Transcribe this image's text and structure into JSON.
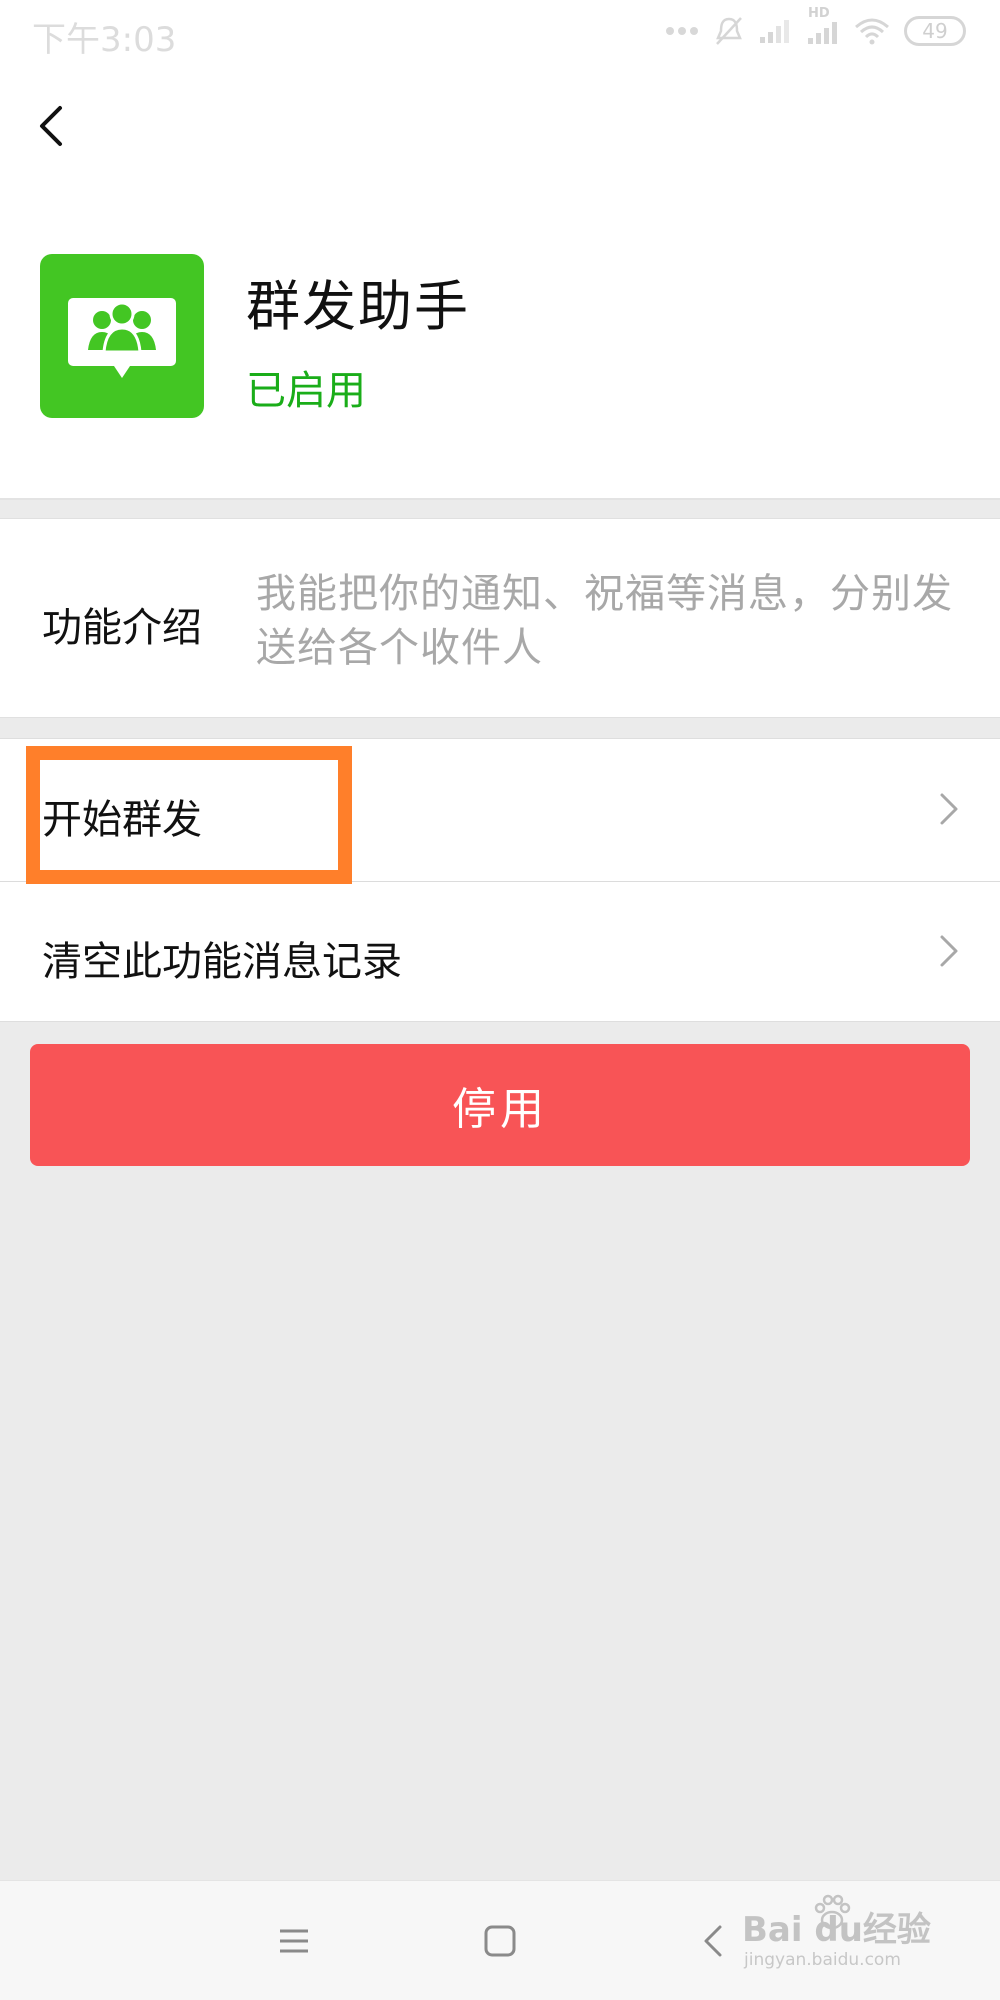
{
  "status_bar": {
    "time": "下午3:03",
    "network_label": "HD",
    "battery": "49"
  },
  "app": {
    "title": "群发助手",
    "status": "已启用",
    "accent_color": "#1aad19",
    "icon": "group-chat-icon"
  },
  "intro": {
    "label": "功能介绍",
    "text": "我能把你的通知、祝福等消息，分别发送给各个收件人"
  },
  "menu": {
    "items": [
      {
        "label": "开始群发",
        "icon": "chevron-right-icon"
      },
      {
        "label": "清空此功能消息记录",
        "icon": "chevron-right-icon"
      }
    ]
  },
  "actions": {
    "disable_label": "停用",
    "disable_color": "#f85456"
  },
  "highlight": {
    "color": "#ff7f2a"
  },
  "nav_bar": {
    "icons": [
      "menu-icon",
      "home-icon",
      "back-icon"
    ]
  },
  "watermark": {
    "main": "Bai du经验",
    "sub": "jingyan.baidu.com"
  }
}
